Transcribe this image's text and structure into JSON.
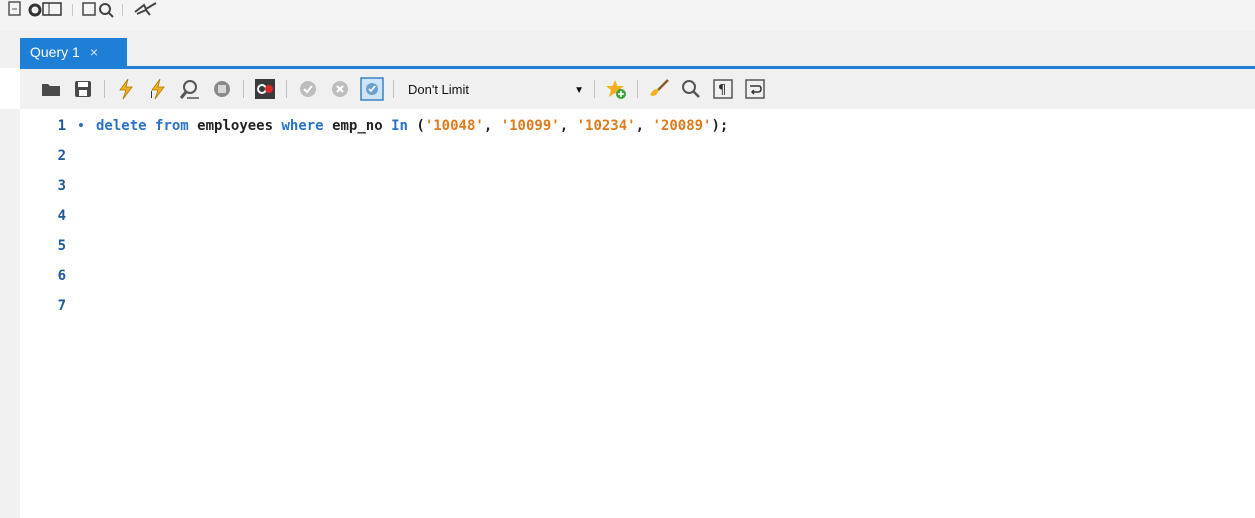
{
  "tab": {
    "label": "Query 1",
    "close": "×"
  },
  "toolbar": {
    "limit_select": {
      "value": "Don't Limit"
    }
  },
  "editor": {
    "line_numbers": [
      "1",
      "2",
      "3",
      "4",
      "5",
      "6",
      "7"
    ],
    "line1": {
      "kw_delete": "delete",
      "kw_from": "from",
      "table": "employees",
      "kw_where": "where",
      "column": "emp_no",
      "kw_in": "In",
      "open": "(",
      "v1": "'10048'",
      "v2": "'10099'",
      "v3": "'10234'",
      "v4": "'20089'",
      "comma": ",",
      "close": ");"
    },
    "marker": "•"
  }
}
